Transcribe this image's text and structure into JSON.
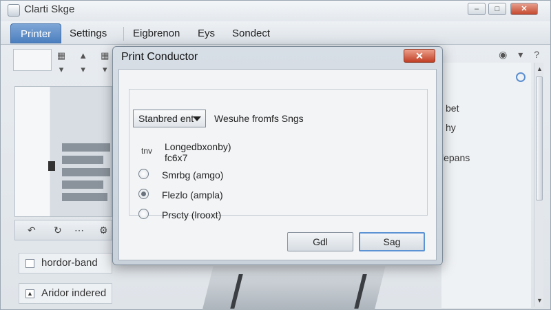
{
  "app": {
    "title": "Clarti Skge",
    "tabs": [
      "Printer",
      "Settings",
      "Eigbrenon",
      "Eys",
      "Sondect"
    ],
    "sidebar_items": [
      "hordor-band",
      "Aridor indered"
    ],
    "right_texts": [
      "bet",
      "hy",
      "lepans"
    ]
  },
  "dialog": {
    "title": "Print Conductor",
    "dropdown_value": "Stanbred ent",
    "dropdown_caption": "Wesuhe fromfs Sngs",
    "option_mark": "tnv",
    "option_first_label_line1": "Longedbxonby)",
    "option_first_label_line2": "fc6x7",
    "radio_options": [
      {
        "label": "Smrbg (amgo)",
        "checked": false
      },
      {
        "label": "Flezlo (ampla)",
        "checked": true
      },
      {
        "label": "Prscty (lrooxt)",
        "checked": false
      }
    ],
    "buttons": {
      "secondary": "Gdl",
      "primary": "Sag"
    }
  },
  "colors": {
    "active_tab": "#4c7fbf",
    "close_button": "#c13f25",
    "primary_focus": "#5c93d4"
  }
}
